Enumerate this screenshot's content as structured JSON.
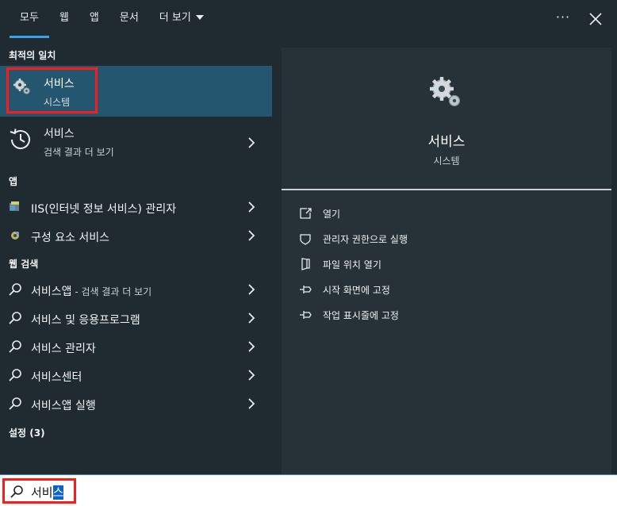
{
  "tabs": [
    "모두",
    "웹",
    "앱",
    "문서",
    "더 보기"
  ],
  "header": {
    "more_label": "···"
  },
  "sections": {
    "best_match": "최적의 일치",
    "apps": "앱",
    "web_search": "웹 검색",
    "settings": "설정 (3)"
  },
  "best_match": {
    "title": "서비스",
    "subtitle": "시스템"
  },
  "search_result": {
    "title": "서비스",
    "subtitle": "검색 결과 더 보기"
  },
  "apps": [
    {
      "label": "IIS(인터넷 정보 서비스) 관리자",
      "icon": "iis-manager-icon"
    },
    {
      "label": "구성 요소 서비스",
      "icon": "component-services-icon"
    }
  ],
  "web_results": [
    {
      "label": "서비스앱",
      "suffix": " - 검색 결과 더 보기"
    },
    {
      "label": "서비스 및 응용프로그램",
      "suffix": ""
    },
    {
      "label": "서비스 관리자",
      "suffix": ""
    },
    {
      "label": "서비스센터",
      "suffix": ""
    },
    {
      "label": "서비스앱 실행",
      "suffix": ""
    }
  ],
  "detail": {
    "title": "서비스",
    "subtitle": "시스템",
    "actions": [
      {
        "label": "열기",
        "icon": "open-icon"
      },
      {
        "label": "관리자 권한으로 실행",
        "icon": "shield-icon"
      },
      {
        "label": "파일 위치 열기",
        "icon": "file-location-icon"
      },
      {
        "label": "시작 화면에 고정",
        "icon": "pin-icon"
      },
      {
        "label": "작업 표시줄에 고정",
        "icon": "pin-icon"
      }
    ]
  },
  "search": {
    "text_plain": "서비",
    "text_selected": "스"
  },
  "colors": {
    "background": "#1f2b31",
    "panel": "#263238",
    "selected_row": "#24576f",
    "accent": "#3aa0e8",
    "highlight_box": "#ff1a1a"
  }
}
